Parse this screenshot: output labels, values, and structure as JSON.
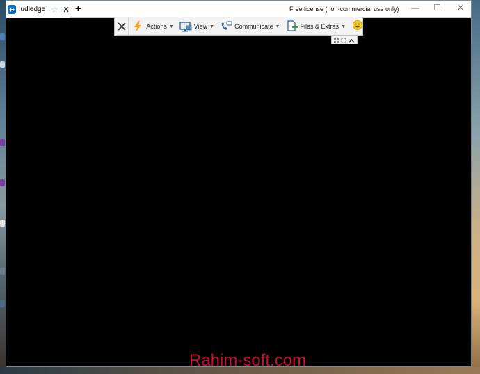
{
  "window": {
    "tab_title": "udledge",
    "star_glyph": "☆",
    "close_glyph": "✕",
    "new_tab_glyph": "+",
    "license_text": "Free license (non-commercial use only)",
    "minimize_glyph": "—",
    "maximize_glyph": "☐",
    "window_close_glyph": "✕"
  },
  "toolbar": {
    "close_icon": "close-icon",
    "items": [
      {
        "label": "Actions",
        "icon": "lightning-icon",
        "caret": "▼"
      },
      {
        "label": "View",
        "icon": "monitor-icon",
        "caret": "▼"
      },
      {
        "label": "Communicate",
        "icon": "phone-icon",
        "caret": "▼"
      },
      {
        "label": "Files & Extras",
        "icon": "file-transfer-icon",
        "caret": "▼"
      }
    ],
    "smiley_icon": "smiley-icon",
    "accent_color": "#f5a623"
  },
  "subbar": {
    "icons": [
      "grid-icon",
      "fullscreen-icon",
      "collapse-icon"
    ]
  },
  "watermark": "Rahim-soft.com"
}
